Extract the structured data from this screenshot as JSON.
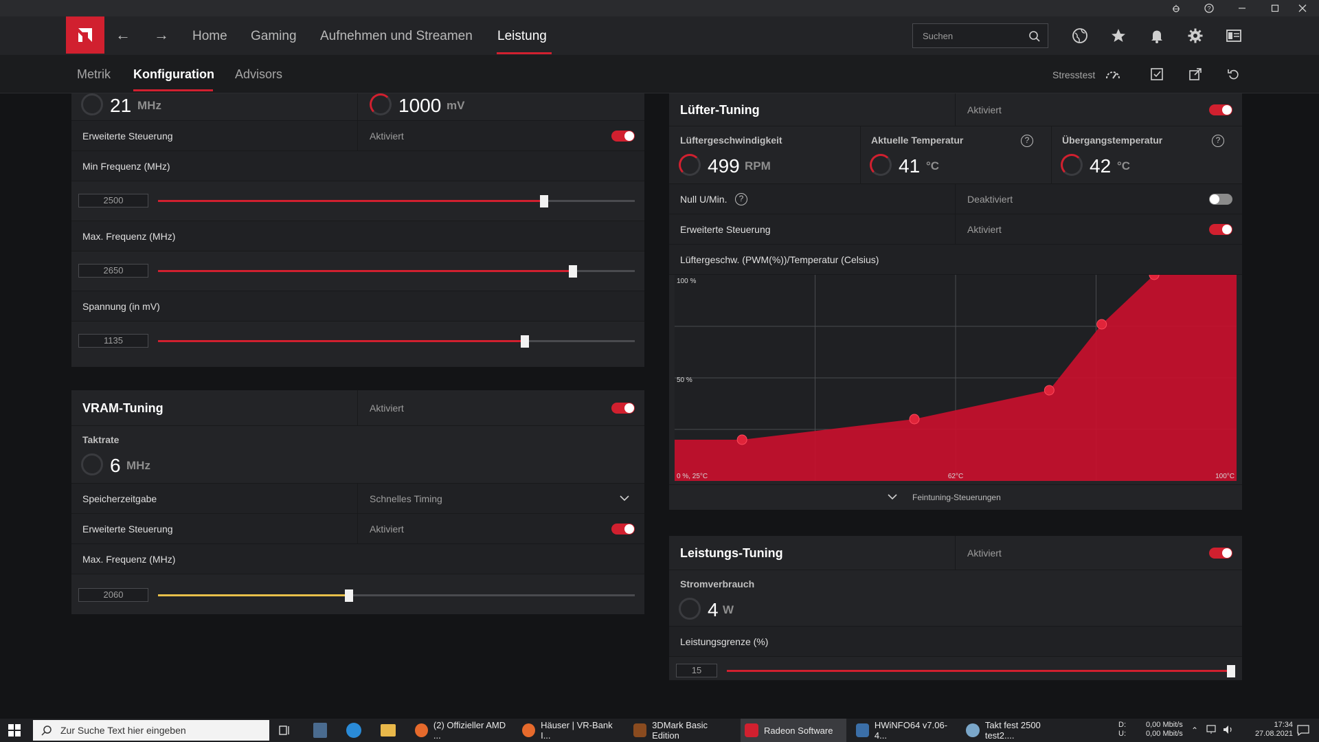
{
  "nav": {
    "items": [
      "Home",
      "Gaming",
      "Aufnehmen und Streamen",
      "Leistung"
    ],
    "search_placeholder": "Suchen"
  },
  "subnav": {
    "tabs": [
      "Metrik",
      "Konfiguration",
      "Advisors"
    ],
    "stress_label": "Stresstest"
  },
  "gpu": {
    "clock_value": "21",
    "clock_unit": "MHz",
    "voltage_value": "1000",
    "voltage_unit": "mV",
    "advanced_label": "Erweiterte Steuerung",
    "advanced_state": "Aktiviert",
    "min_freq_label": "Min Frequenz (MHz)",
    "min_freq_value": "2500",
    "min_freq_fraction": 0.81,
    "max_freq_label": "Max. Frequenz (MHz)",
    "max_freq_value": "2650",
    "max_freq_fraction": 0.87,
    "voltage_label": "Spannung (in mV)",
    "voltage_slider_value": "1135",
    "voltage_fraction": 0.77
  },
  "vram": {
    "title": "VRAM-Tuning",
    "state": "Aktiviert",
    "clock_label": "Taktrate",
    "clock_value": "6",
    "clock_unit": "MHz",
    "timing_label": "Speicherzeitgabe",
    "timing_value": "Schnelles Timing",
    "advanced_label": "Erweiterte Steuerung",
    "advanced_state": "Aktiviert",
    "max_freq_label": "Max. Frequenz (MHz)",
    "max_freq_value": "2060",
    "max_freq_fraction": 0.4
  },
  "fan": {
    "title": "Lüfter-Tuning",
    "state": "Aktiviert",
    "speed_label": "Lüftergeschwindigkeit",
    "speed_value": "499",
    "speed_unit": "RPM",
    "temp_label": "Aktuelle Temperatur",
    "temp_value": "41",
    "temp_unit": "°C",
    "junction_label": "Übergangstemperatur",
    "junction_value": "42",
    "junction_unit": "°C",
    "zero_rpm_label": "Null U/Min.",
    "zero_rpm_state": "Deaktiviert",
    "advanced_label": "Erweiterte Steuerung",
    "advanced_state": "Aktiviert",
    "chart_title": "Lüftergeschw. (PWM(%))/Temperatur (Celsius)",
    "fine_tuning_label": "Feintuning-Steuerungen"
  },
  "power": {
    "title": "Leistungs-Tuning",
    "state": "Aktiviert",
    "consumption_label": "Stromverbrauch",
    "consumption_value": "4",
    "consumption_unit": "W",
    "limit_label": "Leistungsgrenze (%)",
    "limit_value": "15",
    "limit_fraction": 1.0
  },
  "chart_data": {
    "type": "area",
    "title": "Lüftergeschw. (PWM(%))/Temperatur (Celsius)",
    "x_label_left": "0 %, 25°C",
    "x_label_mid": "62°C",
    "x_label_right": "100°C",
    "y_label_top": "100 %",
    "y_label_mid": "50 %",
    "xlim": [
      25,
      100
    ],
    "ylim": [
      0,
      100
    ],
    "x": [
      25,
      34,
      57,
      75,
      82,
      89,
      100
    ],
    "y": [
      20,
      20,
      30,
      44,
      76,
      100,
      100
    ],
    "points_x": [
      34,
      57,
      75,
      82,
      89
    ],
    "points_y": [
      20,
      30,
      44,
      76,
      100
    ],
    "color": "#c8102e"
  },
  "taskbar": {
    "search": "Zur Suche Text hier eingeben",
    "apps": [
      "(2) Offizieller AMD ...",
      "Häuser | VR-Bank I...",
      "3DMark Basic Edition",
      "Radeon Software",
      "HWiNFO64 v7.06-4...",
      "Takt fest 2500 test2...."
    ],
    "net_d_label": "D:",
    "net_u_label": "U:",
    "net_d": "0,00 Mbit/s",
    "net_u": "0,00 Mbit/s",
    "time": "17:34",
    "date": "27.08.2021"
  },
  "colors": {
    "accent": "#d1202f",
    "yellow": "#e8c04a"
  }
}
